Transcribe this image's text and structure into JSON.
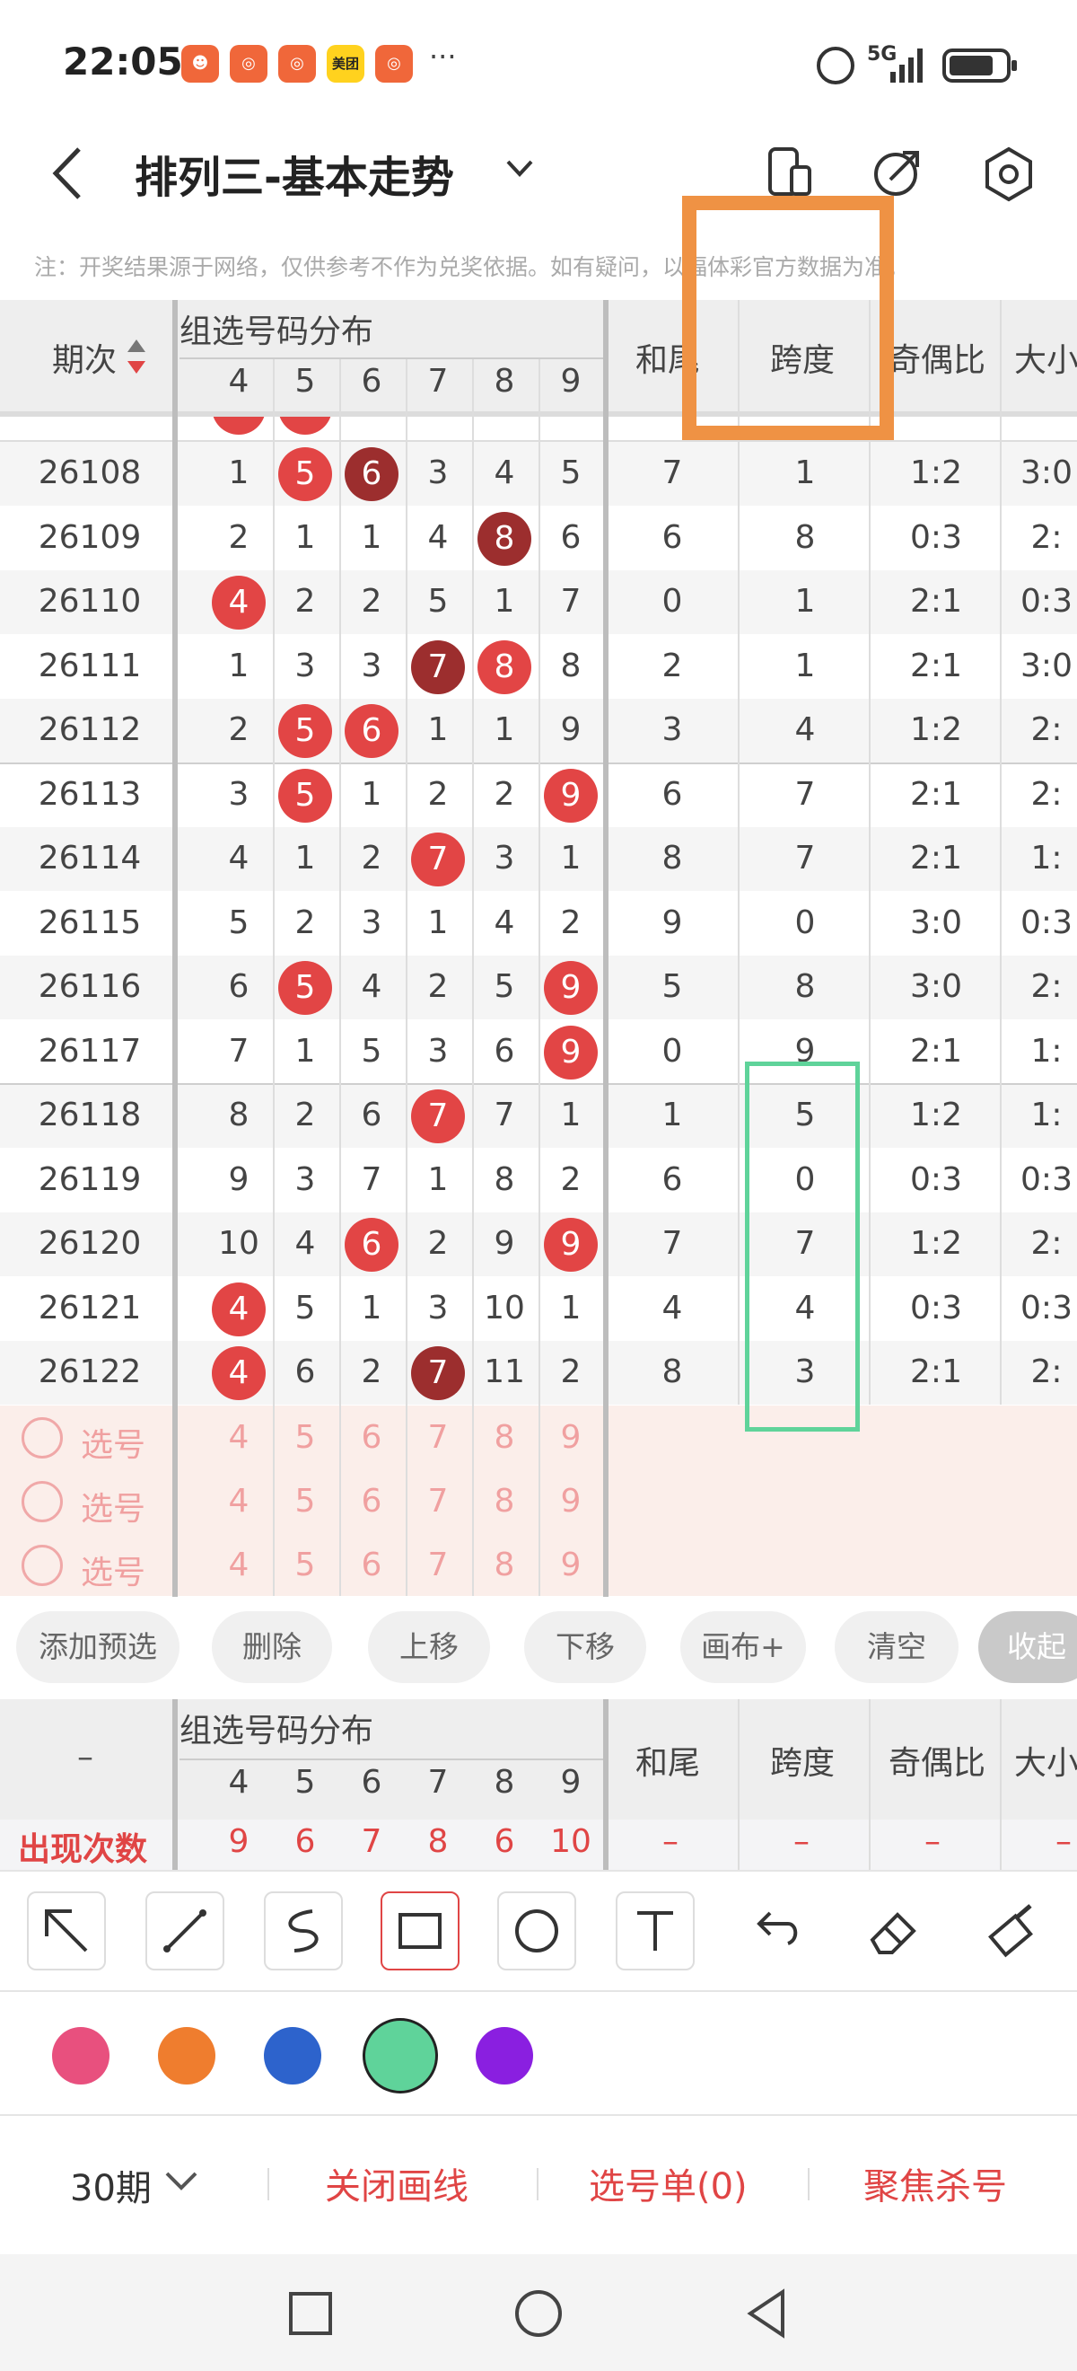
{
  "statusbar": {
    "time": "22:05",
    "more": "···",
    "network": "5G",
    "app_badge": "美团"
  },
  "header": {
    "title": "排列三-基本走势"
  },
  "notice": "注：开奖结果源于网络，仅供参考不作为兑奖依据。如有疑问，以福体彩官方数据为准。",
  "table": {
    "col_period": "期次",
    "group_header": "组选号码分布",
    "digits": [
      "4",
      "5",
      "6",
      "7",
      "8",
      "9"
    ],
    "col_hewei": "和尾",
    "col_kuadu": "跨度",
    "col_jiou": "奇偶比",
    "col_daxiao": "大小",
    "rows": [
      {
        "period": "26108",
        "d": [
          "1",
          "5",
          "6",
          "3",
          "4",
          "5"
        ],
        "hit": [
          "",
          "r",
          "d",
          "",
          "",
          ""
        ],
        "hewei": "7",
        "kuadu": "1",
        "jiou": "1:2",
        "daxiao": "3:0"
      },
      {
        "period": "26109",
        "d": [
          "2",
          "1",
          "1",
          "4",
          "8",
          "6"
        ],
        "hit": [
          "",
          "",
          "",
          "",
          "d",
          ""
        ],
        "hewei": "6",
        "kuadu": "8",
        "jiou": "0:3",
        "daxiao": "2:"
      },
      {
        "period": "26110",
        "d": [
          "4",
          "2",
          "2",
          "5",
          "1",
          "7"
        ],
        "hit": [
          "r",
          "",
          "",
          "",
          "",
          ""
        ],
        "hewei": "0",
        "kuadu": "1",
        "jiou": "2:1",
        "daxiao": "0:3"
      },
      {
        "period": "26111",
        "d": [
          "1",
          "3",
          "3",
          "7",
          "8",
          "8"
        ],
        "hit": [
          "",
          "",
          "",
          "d",
          "r",
          ""
        ],
        "hewei": "2",
        "kuadu": "1",
        "jiou": "2:1",
        "daxiao": "3:0"
      },
      {
        "period": "26112",
        "d": [
          "2",
          "5",
          "6",
          "1",
          "1",
          "9"
        ],
        "hit": [
          "",
          "r",
          "r",
          "",
          "",
          ""
        ],
        "hewei": "3",
        "kuadu": "4",
        "jiou": "1:2",
        "daxiao": "2:"
      },
      {
        "period": "26113",
        "d": [
          "3",
          "5",
          "1",
          "2",
          "2",
          "9"
        ],
        "hit": [
          "",
          "r",
          "",
          "",
          "",
          "r"
        ],
        "hewei": "6",
        "kuadu": "7",
        "jiou": "2:1",
        "daxiao": "2:"
      },
      {
        "period": "26114",
        "d": [
          "4",
          "1",
          "2",
          "7",
          "3",
          "1"
        ],
        "hit": [
          "",
          "",
          "",
          "r",
          "",
          ""
        ],
        "hewei": "8",
        "kuadu": "7",
        "jiou": "2:1",
        "daxiao": "1:"
      },
      {
        "period": "26115",
        "d": [
          "5",
          "2",
          "3",
          "1",
          "4",
          "2"
        ],
        "hit": [
          "",
          "",
          "",
          "",
          "",
          ""
        ],
        "hewei": "9",
        "kuadu": "0",
        "jiou": "3:0",
        "daxiao": "0:3"
      },
      {
        "period": "26116",
        "d": [
          "6",
          "5",
          "4",
          "2",
          "5",
          "9"
        ],
        "hit": [
          "",
          "r",
          "",
          "",
          "",
          "r"
        ],
        "hewei": "5",
        "kuadu": "8",
        "jiou": "3:0",
        "daxiao": "2:"
      },
      {
        "period": "26117",
        "d": [
          "7",
          "1",
          "5",
          "3",
          "6",
          "9"
        ],
        "hit": [
          "",
          "",
          "",
          "",
          "",
          "r"
        ],
        "hewei": "0",
        "kuadu": "9",
        "jiou": "2:1",
        "daxiao": "1:"
      },
      {
        "period": "26118",
        "d": [
          "8",
          "2",
          "6",
          "7",
          "7",
          "1"
        ],
        "hit": [
          "",
          "",
          "",
          "r",
          "",
          ""
        ],
        "hewei": "1",
        "kuadu": "5",
        "jiou": "1:2",
        "daxiao": "1:"
      },
      {
        "period": "26119",
        "d": [
          "9",
          "3",
          "7",
          "1",
          "8",
          "2"
        ],
        "hit": [
          "",
          "",
          "",
          "",
          "",
          ""
        ],
        "hewei": "6",
        "kuadu": "0",
        "jiou": "0:3",
        "daxiao": "0:3"
      },
      {
        "period": "26120",
        "d": [
          "10",
          "4",
          "6",
          "2",
          "9",
          "9"
        ],
        "hit": [
          "",
          "",
          "r",
          "",
          "",
          "r"
        ],
        "hewei": "7",
        "kuadu": "7",
        "jiou": "1:2",
        "daxiao": "2:"
      },
      {
        "period": "26121",
        "d": [
          "4",
          "5",
          "1",
          "3",
          "10",
          "1"
        ],
        "hit": [
          "r",
          "",
          "",
          "",
          "",
          ""
        ],
        "hewei": "4",
        "kuadu": "4",
        "jiou": "0:3",
        "daxiao": "0:3"
      },
      {
        "period": "26122",
        "d": [
          "4",
          "6",
          "2",
          "7",
          "11",
          "2"
        ],
        "hit": [
          "r",
          "",
          "",
          "d",
          "",
          ""
        ],
        "hewei": "8",
        "kuadu": "3",
        "jiou": "2:1",
        "daxiao": "2:"
      }
    ],
    "select_label": "选号",
    "count_label": "出现次数",
    "counts": [
      "9",
      "6",
      "7",
      "8",
      "6",
      "10"
    ],
    "dash": "–"
  },
  "actions": {
    "add": "添加预选",
    "delete": "删除",
    "up": "上移",
    "down": "下移",
    "canvas": "画布+",
    "clear": "清空",
    "collapse": "收起"
  },
  "palette": {
    "colors": [
      "#e8507e",
      "#ef7d2e",
      "#2d63cc",
      "#5fd39a",
      "#8a1fe0"
    ],
    "selected_index": 3
  },
  "bottom": {
    "period": "30期",
    "close_draw": "关闭画线",
    "pick_list": "选号单(0)",
    "focus_kill": "聚焦杀号"
  }
}
